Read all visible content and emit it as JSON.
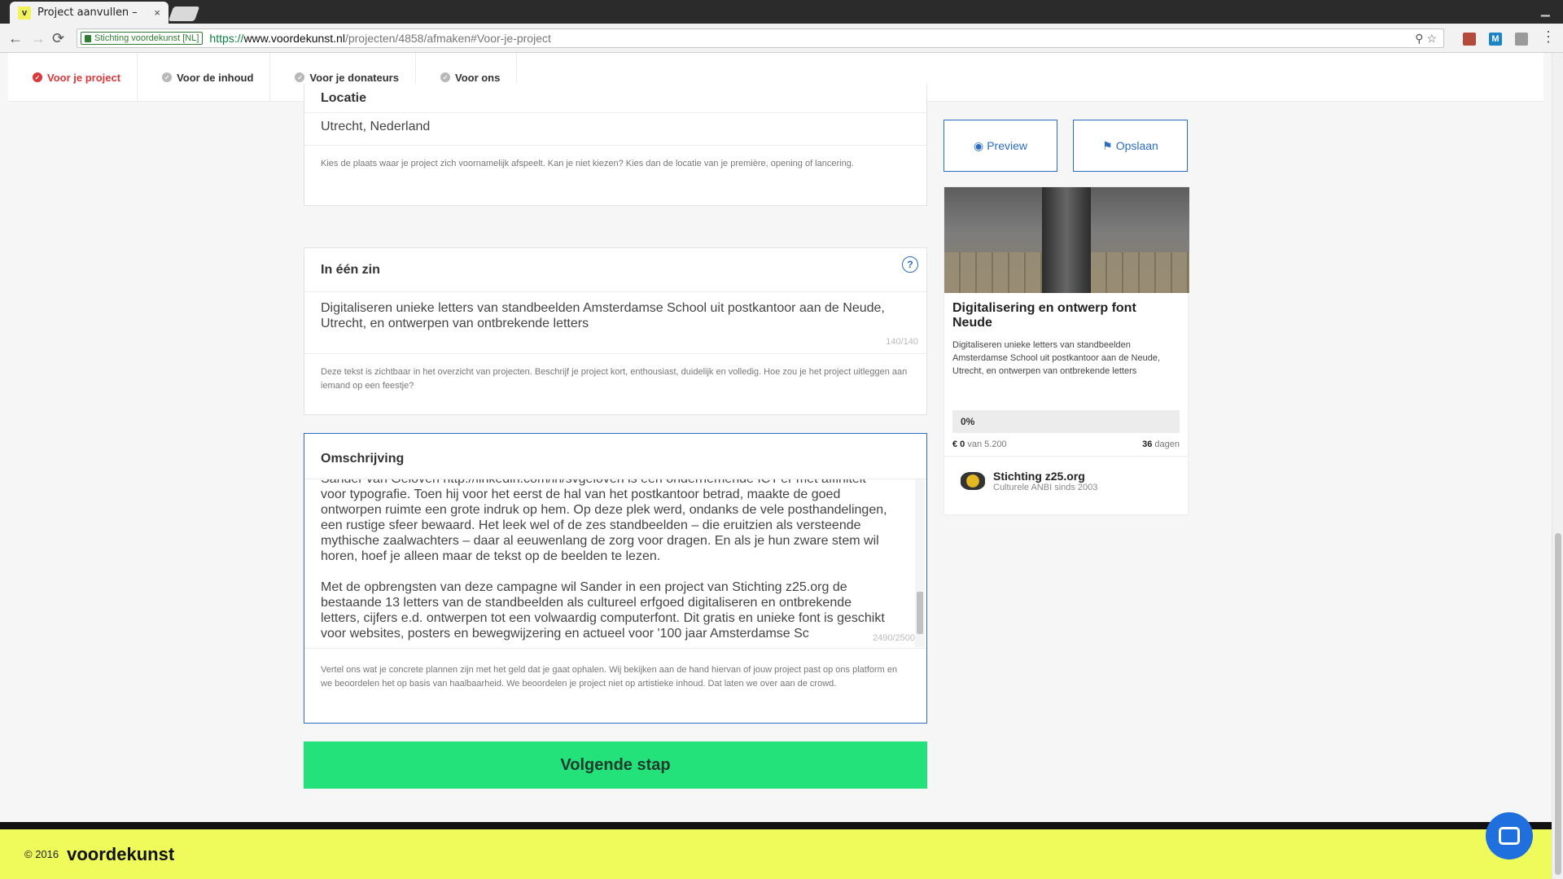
{
  "browser": {
    "tab_title": "Project aanvullen –",
    "tab_favicon": "v",
    "tab_close": "×",
    "secure_label": "Stichting voordekunst [NL]",
    "url_scheme": "https://",
    "url_host": "www.voordekunst.nl",
    "url_path": "/projecten/4858/afmaken#Voor-je-project"
  },
  "subnav": {
    "items": [
      {
        "label": "Voor je project",
        "active": true
      },
      {
        "label": "Voor de inhoud"
      },
      {
        "label": "Voor je donateurs"
      },
      {
        "label": "Voor ons"
      }
    ]
  },
  "locatie": {
    "title": "Locatie",
    "value": "Utrecht, Nederland",
    "help": "Kies de plaats waar je project zich voornamelijk afspeelt. Kan je niet kiezen? Kies dan de locatie van je première, opening of lancering."
  },
  "in_een_zin": {
    "title": "In één zin",
    "help_icon": "?",
    "value": "Digitaliseren unieke letters van standbeelden Amsterdamse School uit postkantoor aan de Neude, Utrecht, en ontwerpen van ontbrekende letters",
    "counter": "140/140",
    "help": "Deze tekst is zichtbaar in het overzicht van projecten. Beschrijf je project kort, enthousiast, duidelijk en volledig. Hoe zou je het project uitleggen aan iemand op een feestje?"
  },
  "omschrijving": {
    "title": "Omschrijving",
    "paragraph1": "Sander van Geloven http://linkedin.com/in/svgeloven is een ondernemende ICT'er met affiniteit voor typografie. Toen hij voor het eerst de hal van het postkantoor betrad, maakte de goed ontworpen ruimte een grote indruk op hem. Op deze plek werd, ondanks de vele posthandelingen, een rustige sfeer bewaard. Het leek wel of de zes standbeelden – die eruitzien als versteende mythische zaalwachters – daar al eeuwenlang de zorg voor dragen. En als je hun zware stem wil horen, hoef je alleen maar de tekst op de beelden te lezen.",
    "paragraph2": "Met de opbrengsten van deze campagne wil Sander in een project van Stichting z25.org de bestaande 13 letters van de standbeelden als cultureel erfgoed digitaliseren en ontbrekende letters, cijfers e.d. ontwerpen tot een volwaardig computerfont. Dit gratis en unieke font is geschikt voor websites, posters en bewegwijzering en actueel voor '100 jaar Amsterdamse Sc",
    "counter": "2490/2500",
    "help": "Vertel ons wat je concrete plannen zijn met het geld dat je gaat ophalen. Wij bekijken aan de hand hiervan of jouw project past op ons platform en we beoordelen het op basis van haalbaarheid. We beoordelen je project niet op artistieke inhoud. Dat laten we over aan de crowd."
  },
  "next_button": "Volgende stap",
  "sidebar": {
    "preview_label": "Preview",
    "save_label": "Opslaan",
    "card": {
      "title": "Digitalisering en ontwerp font Neude",
      "description": "Digitaliseren unieke letters van standbeelden Amsterdamse School uit postkantoor aan de Neude, Utrecht, en ontwerpen van ontbrekende letters",
      "progress": "0%",
      "progress_value": 0,
      "amount": "€ 0",
      "amount_of": "van 5.200",
      "days": "36",
      "days_label": "dagen"
    },
    "org_name": "Stichting z25.org",
    "org_sub": "Culturele ANBI sinds 2003"
  },
  "footer": {
    "copyright": "© 2016",
    "brand": "voordekunst"
  },
  "colors": {
    "accent_blue": "#2b6cc4",
    "active_red": "#d9383a",
    "cta_green": "#24e27a",
    "footer_yellow": "#eefb5a"
  }
}
